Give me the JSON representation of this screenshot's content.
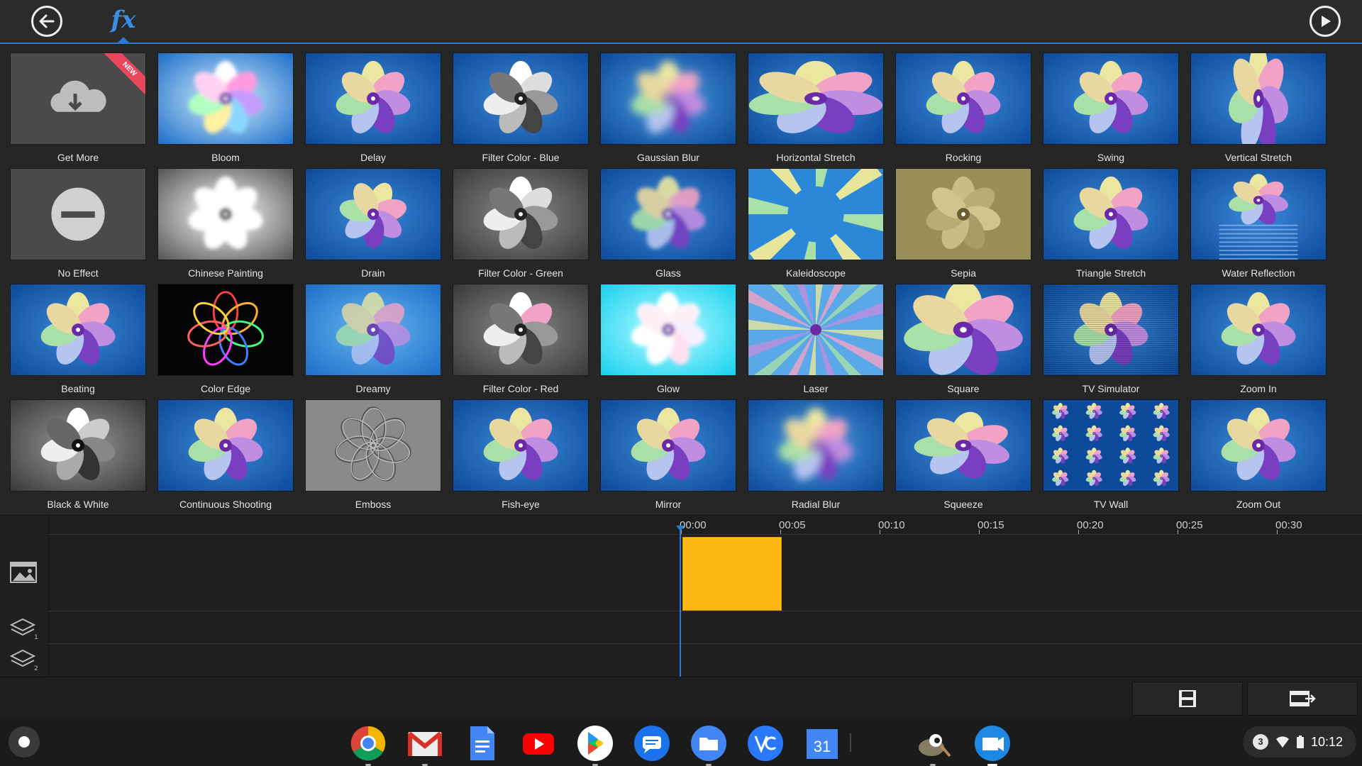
{
  "header": {
    "back_icon": "arrow-left-icon",
    "fx_label": "fx",
    "play_icon": "play-icon"
  },
  "effects": [
    {
      "label": "Get More",
      "thumb": "download",
      "badge": "NEW"
    },
    {
      "label": "Bloom",
      "thumb": "bloom"
    },
    {
      "label": "Delay",
      "thumb": "normal"
    },
    {
      "label": "Filter Color - Blue",
      "thumb": "filter-blue"
    },
    {
      "label": "Gaussian Blur",
      "thumb": "blur"
    },
    {
      "label": "Horizontal Stretch",
      "thumb": "hstretch"
    },
    {
      "label": "Rocking",
      "thumb": "normal"
    },
    {
      "label": "Swing",
      "thumb": "normal"
    },
    {
      "label": "Vertical Stretch",
      "thumb": "vstretch"
    },
    {
      "label": "No Effect",
      "thumb": "none"
    },
    {
      "label": "Chinese Painting",
      "thumb": "chinese"
    },
    {
      "label": "Drain",
      "thumb": "drain"
    },
    {
      "label": "Filter Color - Green",
      "thumb": "gray"
    },
    {
      "label": "Glass",
      "thumb": "glass"
    },
    {
      "label": "Kaleidoscope",
      "thumb": "kaleido"
    },
    {
      "label": "Sepia",
      "thumb": "sepia"
    },
    {
      "label": "Triangle Stretch",
      "thumb": "normal"
    },
    {
      "label": "Water Reflection",
      "thumb": "water"
    },
    {
      "label": "Beating",
      "thumb": "normal"
    },
    {
      "label": "Color Edge",
      "thumb": "coloredge"
    },
    {
      "label": "Dreamy",
      "thumb": "dreamy"
    },
    {
      "label": "Filter Color - Red",
      "thumb": "filter-red"
    },
    {
      "label": "Glow",
      "thumb": "glow"
    },
    {
      "label": "Laser",
      "thumb": "laser"
    },
    {
      "label": "Square",
      "thumb": "square"
    },
    {
      "label": "TV Simulator",
      "thumb": "tv"
    },
    {
      "label": "Zoom In",
      "thumb": "normal"
    },
    {
      "label": "Black & White",
      "thumb": "bw"
    },
    {
      "label": "Continuous Shooting",
      "thumb": "normal"
    },
    {
      "label": "Emboss",
      "thumb": "emboss"
    },
    {
      "label": "Fish-eye",
      "thumb": "normal"
    },
    {
      "label": "Mirror",
      "thumb": "normal"
    },
    {
      "label": "Radial Blur",
      "thumb": "blur"
    },
    {
      "label": "Squeeze",
      "thumb": "squeeze"
    },
    {
      "label": "TV Wall",
      "thumb": "tvwall"
    },
    {
      "label": "Zoom Out",
      "thumb": "normal"
    }
  ],
  "timeline": {
    "ticks": [
      "00:00",
      "00:05",
      "00:10",
      "00:15",
      "00:20",
      "00:25",
      "00:30"
    ],
    "clip_color": "#fdb913",
    "playhead_color": "#2a7ad1"
  },
  "bottom_controls": {
    "save_icon": "save-icon",
    "export_icon": "export-video-icon"
  },
  "shelf": {
    "apps": [
      "chrome",
      "gmail",
      "docs",
      "youtube",
      "play-store",
      "messages",
      "files",
      "vectr",
      "calendar",
      "gimp",
      "video-editor"
    ],
    "calendar_day": "31",
    "notification_count": "3",
    "time": "10:12"
  },
  "colors": {
    "accent": "#2a7ad1",
    "new_badge": "#e8465c"
  }
}
